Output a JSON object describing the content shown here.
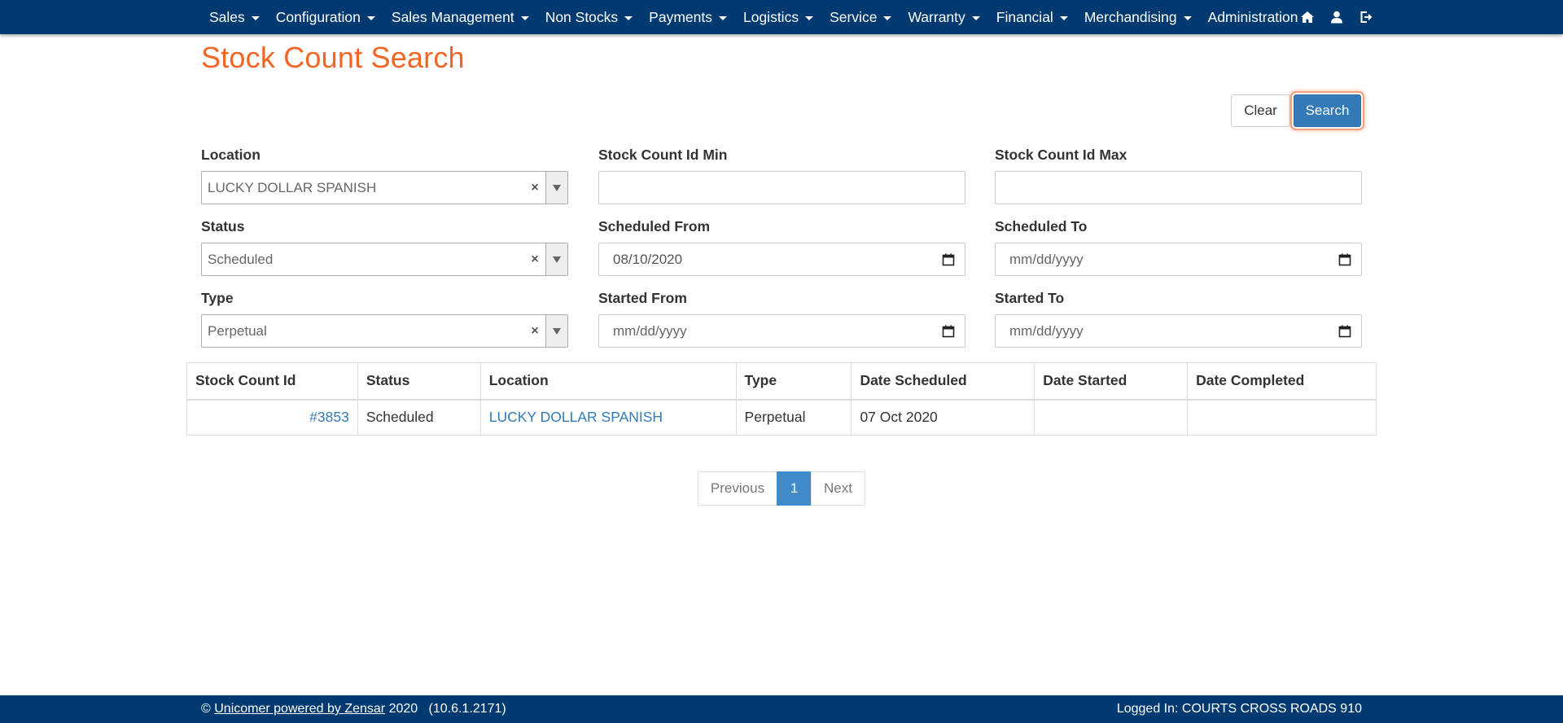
{
  "nav": {
    "items": [
      "Sales",
      "Configuration",
      "Sales Management",
      "Non Stocks",
      "Payments",
      "Logistics",
      "Service",
      "Warranty",
      "Financial",
      "Merchandising",
      "Administration"
    ],
    "icons": [
      "home-icon",
      "user-icon",
      "logout-icon"
    ]
  },
  "page": {
    "title": "Stock Count Search"
  },
  "actions": {
    "clear_label": "Clear",
    "search_label": "Search"
  },
  "form": {
    "location": {
      "label": "Location",
      "value": "LUCKY DOLLAR SPANISH"
    },
    "status": {
      "label": "Status",
      "value": "Scheduled"
    },
    "type": {
      "label": "Type",
      "value": "Perpetual"
    },
    "id_min": {
      "label": "Stock Count Id Min",
      "value": ""
    },
    "id_max": {
      "label": "Stock Count Id Max",
      "value": ""
    },
    "scheduled_from": {
      "label": "Scheduled From",
      "value": "08/10/2020"
    },
    "scheduled_to": {
      "label": "Scheduled To",
      "placeholder": "mm/dd/yyyy"
    },
    "started_from": {
      "label": "Started From",
      "placeholder": "mm/dd/yyyy"
    },
    "started_to": {
      "label": "Started To",
      "placeholder": "mm/dd/yyyy"
    },
    "clear_symbol": "×"
  },
  "table": {
    "columns": [
      "Stock Count Id",
      "Status",
      "Location",
      "Type",
      "Date Scheduled",
      "Date Started",
      "Date Completed"
    ],
    "rows": [
      {
        "id": "#3853",
        "status": "Scheduled",
        "location": "LUCKY DOLLAR SPANISH",
        "type": "Perpetual",
        "date_scheduled": "07 Oct 2020",
        "date_started": "",
        "date_completed": ""
      }
    ]
  },
  "pagination": {
    "previous": "Previous",
    "current": "1",
    "next": "Next"
  },
  "footer": {
    "copyright": "©",
    "company_link": "Unicomer powered by Zensar",
    "year_version": "2020   (10.6.1.2171)",
    "logged_in": "Logged In: COURTS CROSS ROADS 910"
  },
  "colors": {
    "navbar": "#003a70",
    "title": "#f26522",
    "primary": "#337ab7",
    "link": "#337ab7"
  }
}
